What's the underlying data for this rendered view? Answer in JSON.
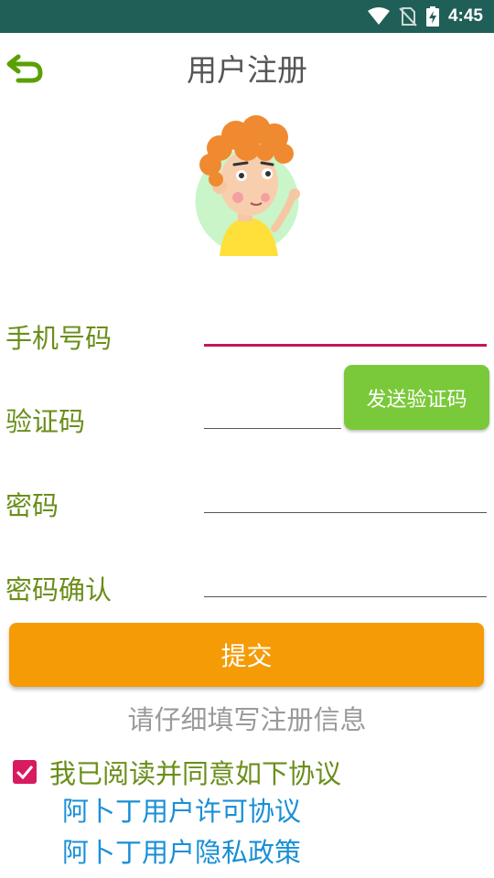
{
  "status_bar": {
    "time": "4:45"
  },
  "header": {
    "title": "用户注册"
  },
  "form": {
    "phone_label": "手机号码",
    "code_label": "验证码",
    "password_label": "密码",
    "confirm_label": "密码确认",
    "phone_value": "",
    "code_value": "",
    "password_value": "",
    "confirm_value": "",
    "send_code_label": "发送验证码",
    "submit_label": "提交"
  },
  "hint": "请仔细填写注册信息",
  "agreement": {
    "checked": true,
    "text": "我已阅读并同意如下协议",
    "links": [
      "阿卜丁用户许可协议",
      "阿卜丁用户隐私政策"
    ]
  },
  "colors": {
    "status_bar": "#1f5f57",
    "accent_green": "#7ac93a",
    "label_green": "#6a8e1a",
    "submit_orange": "#f59b06",
    "checkbox_pink": "#d81b60",
    "link_blue": "#1a8fd6"
  }
}
